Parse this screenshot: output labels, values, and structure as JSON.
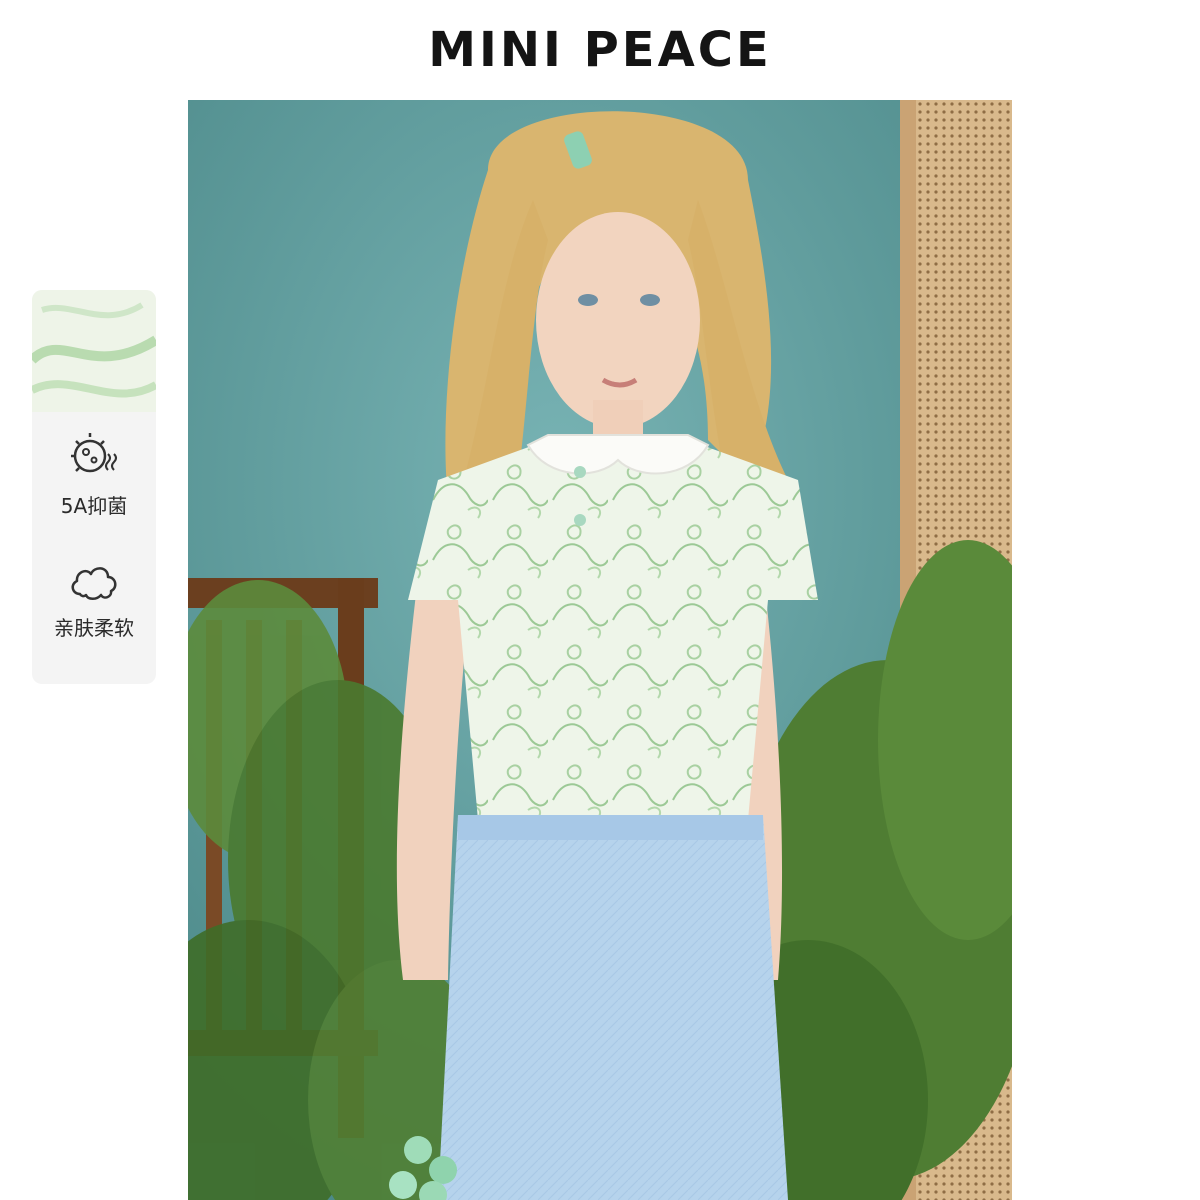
{
  "brand": {
    "title": "MINI PEACE"
  },
  "product_photo": {
    "subject": "girl-in-floral-polo-shirt"
  },
  "features": [
    {
      "icon": "antibacterial-icon",
      "label": "5A抑菌"
    },
    {
      "icon": "cloud-soft-icon",
      "label": "亲肤柔软"
    }
  ],
  "colors": {
    "background": "#ffffff",
    "panel": "#f4f4f4",
    "teal_wall": "#5f9d9e",
    "shirt_green": "#9cc996",
    "pants_blue": "#b6d3ec"
  }
}
